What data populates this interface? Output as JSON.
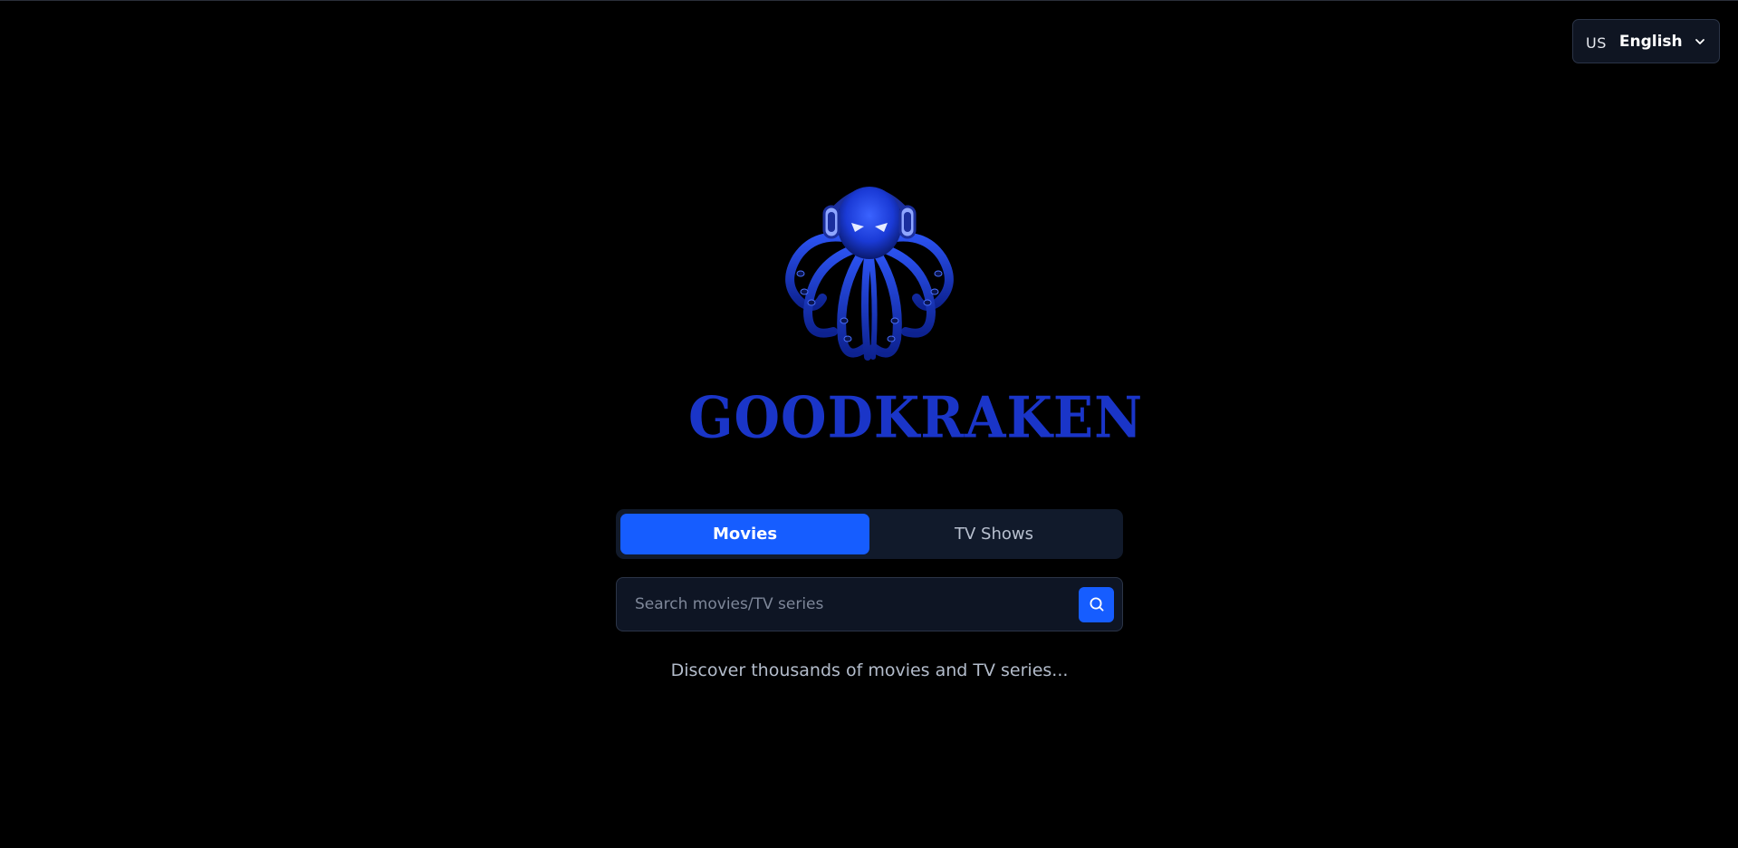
{
  "language_selector": {
    "flag_code": "US",
    "label": "English",
    "icon": "chevron-down-icon"
  },
  "brand": {
    "logo_icon": "octopus-headphones-logo",
    "name": "GOODKRAKEN",
    "color": "#1a35c8"
  },
  "tabs": [
    {
      "label": "Movies",
      "active": true
    },
    {
      "label": "TV Shows",
      "active": false
    }
  ],
  "search": {
    "value": "",
    "placeholder": "Search movies/TV series",
    "icon": "search-icon"
  },
  "tagline": "Discover thousands of movies and TV series...",
  "colors": {
    "background": "#000000",
    "accent": "#165dff",
    "panel": "#111a2b"
  }
}
